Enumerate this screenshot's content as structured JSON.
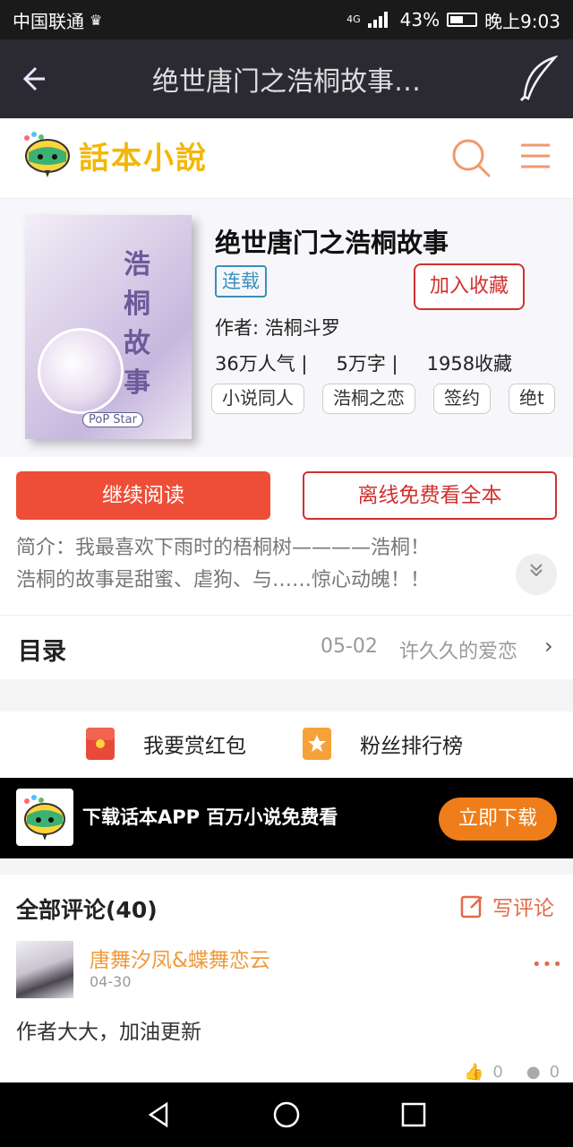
{
  "status_bar": {
    "carrier": "中国联通",
    "network": "4G",
    "battery": "43%",
    "time": "晚上9:03"
  },
  "app_bar": {
    "title": "绝世唐门之浩桐故事…"
  },
  "site_header": {
    "logo_text": "話本小說"
  },
  "book": {
    "cover_text": "浩桐故事",
    "cover_badge": "PoP Star",
    "title": "绝世唐门之浩桐故事",
    "status": "连载",
    "favorite_label": "加入收藏",
    "author": "作者: 浩桐斗罗",
    "popularity": "36万人气 |",
    "words": "5万字 |",
    "collections": "1958收藏",
    "tags": [
      "小说同人",
      "浩桐之恋",
      "签约",
      "绝t"
    ]
  },
  "actions": {
    "read_label": "继续阅读",
    "offline_label": "离线免费看全本",
    "intro_line1": "简介：我最喜欢下雨时的梧桐树————浩桐！",
    "intro_line2": "浩桐的故事是甜蜜、虐狗、与……惊心动魄！！"
  },
  "catalog": {
    "label": "目录",
    "date": "05-02",
    "latest_chapter": "许久久的爱恋"
  },
  "reward": {
    "red_packet": "我要赏红包",
    "fan_ranking": "粉丝排行榜"
  },
  "banner": {
    "text": "下载话本APP 百万小说免费看",
    "download_label": "立即下载"
  },
  "comments": {
    "header": "全部评论(40)",
    "write_label": "写评论",
    "items": [
      {
        "user": "唐舞汐凤&蝶舞恋云",
        "date": "04-30",
        "text": "作者大大，加油更新",
        "likes": "0",
        "replies": "0"
      }
    ]
  },
  "colors": {
    "accent_red": "#ee4e37",
    "border_red": "#d0312d",
    "orange": "#ef7d1a",
    "status_blue": "#3b8fb8"
  }
}
